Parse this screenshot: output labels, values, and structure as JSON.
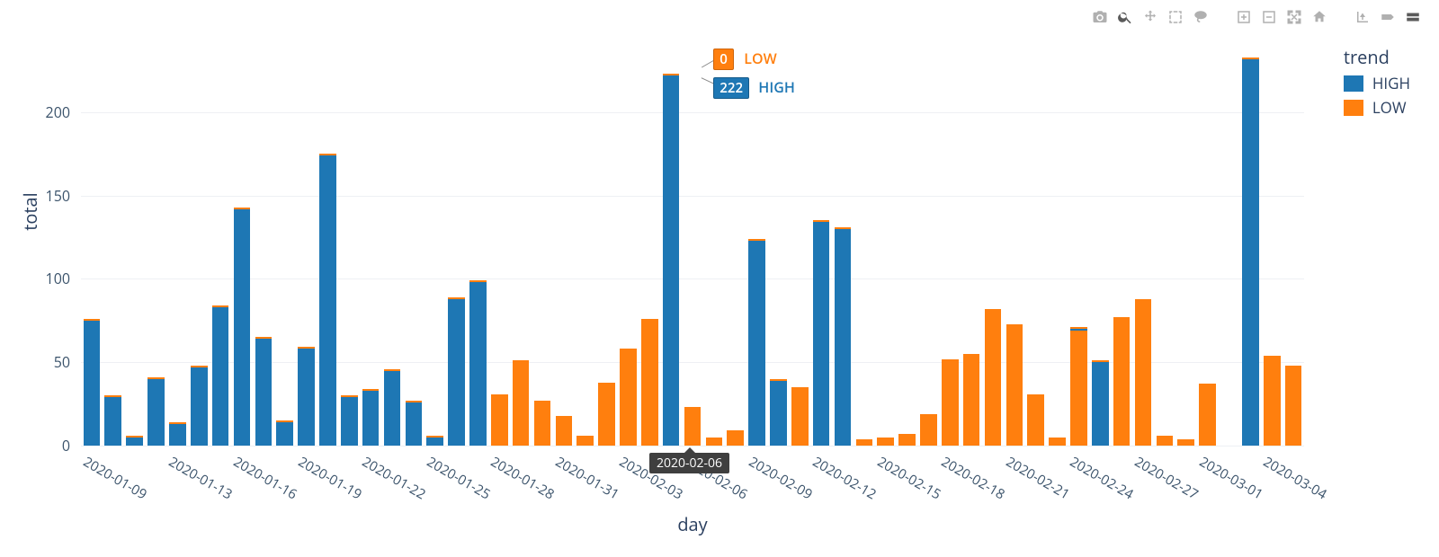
{
  "chart_data": {
    "type": "bar",
    "xlabel": "day",
    "ylabel": "total",
    "ylim": [
      0,
      235
    ],
    "yticks": [
      0,
      50,
      100,
      150,
      200
    ],
    "xticks": [
      "2020-01-09",
      "2020-01-13",
      "2020-01-16",
      "2020-01-19",
      "2020-01-22",
      "2020-01-25",
      "2020-01-28",
      "2020-01-31",
      "2020-02-03",
      "2020-02-06",
      "2020-02-09",
      "2020-02-12",
      "2020-02-15",
      "2020-02-18",
      "2020-02-21",
      "2020-02-24",
      "2020-02-27",
      "2020-03-01",
      "2020-03-04"
    ],
    "categories": [
      "2020-01-09",
      "2020-01-10",
      "2020-01-11",
      "2020-01-12",
      "2020-01-13",
      "2020-01-14",
      "2020-01-15",
      "2020-01-16",
      "2020-01-17",
      "2020-01-18",
      "2020-01-19",
      "2020-01-20",
      "2020-01-21",
      "2020-01-22",
      "2020-01-23",
      "2020-01-24",
      "2020-01-25",
      "2020-01-26",
      "2020-01-27",
      "2020-01-28",
      "2020-01-29",
      "2020-01-30",
      "2020-01-31",
      "2020-02-01",
      "2020-02-02",
      "2020-02-03",
      "2020-02-04",
      "2020-02-05",
      "2020-02-06",
      "2020-02-07",
      "2020-02-08",
      "2020-02-09",
      "2020-02-10",
      "2020-02-11",
      "2020-02-12",
      "2020-02-13",
      "2020-02-14",
      "2020-02-15",
      "2020-02-16",
      "2020-02-17",
      "2020-02-18",
      "2020-02-19",
      "2020-02-20",
      "2020-02-21",
      "2020-02-22",
      "2020-02-23",
      "2020-02-24",
      "2020-02-25",
      "2020-02-26",
      "2020-02-27",
      "2020-02-28",
      "2020-02-29",
      "2020-03-01",
      "2020-03-02",
      "2020-03-03",
      "2020-03-04",
      "2020-03-05"
    ],
    "series": [
      {
        "name": "HIGH",
        "color": "#1e77b4",
        "values": [
          75,
          29,
          5,
          40,
          13,
          47,
          83,
          142,
          64,
          14,
          58,
          174,
          29,
          33,
          45,
          26,
          5,
          88,
          98,
          null,
          null,
          null,
          null,
          null,
          null,
          null,
          null,
          222,
          null,
          null,
          null,
          123,
          39,
          null,
          134,
          130,
          null,
          null,
          null,
          null,
          null,
          null,
          null,
          null,
          null,
          null,
          70,
          50,
          null,
          null,
          null,
          null,
          null,
          null,
          232,
          null,
          null
        ]
      },
      {
        "name": "LOW",
        "color": "#ff7f0e",
        "values": [
          null,
          null,
          null,
          null,
          null,
          null,
          null,
          null,
          null,
          null,
          null,
          null,
          null,
          null,
          null,
          null,
          null,
          null,
          null,
          31,
          51,
          27,
          18,
          6,
          38,
          58,
          76,
          0,
          23,
          5,
          9,
          null,
          null,
          35,
          null,
          null,
          4,
          5,
          7,
          19,
          52,
          55,
          82,
          73,
          31,
          5,
          69,
          null,
          77,
          88,
          6,
          4,
          37,
          null,
          null,
          54,
          48
        ]
      }
    ],
    "legend_title": "trend",
    "hover": {
      "category": "2020-02-06",
      "low_value": 0,
      "low_label": "LOW",
      "high_value": 222,
      "high_label": "HIGH"
    }
  },
  "toolbar": {
    "items": [
      "camera",
      "zoom",
      "pan",
      "box-select",
      "lasso",
      "zoom-in",
      "zoom-out",
      "autoscale",
      "reset",
      "spike",
      "hover-closest",
      "hover-compare"
    ]
  }
}
